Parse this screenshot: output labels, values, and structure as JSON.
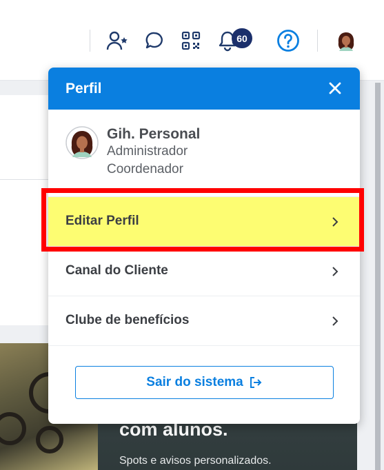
{
  "header": {
    "notification_count": "60",
    "icons": [
      "user-star-icon",
      "chat-icon",
      "qr-code-icon",
      "bell-icon",
      "help-icon"
    ]
  },
  "background": {
    "promo_title": "com alunos.",
    "promo_subtitle": "Spots e avisos personalizados."
  },
  "profile_popup": {
    "title": "Perfil",
    "user": {
      "name": "Gih. Personal",
      "role_1": "Administrador",
      "role_2": "Coordenador"
    },
    "menu": [
      {
        "label": "Editar Perfil",
        "highlighted": true
      },
      {
        "label": "Canal do Cliente",
        "highlighted": false
      },
      {
        "label": "Clube de benefícios",
        "highlighted": false
      }
    ],
    "logout_label": "Sair do sistema"
  },
  "colors": {
    "accent": "#0a7fe0",
    "badge": "#1b2f6b",
    "highlight": "#fdfd72",
    "annotation": "#ff0000"
  }
}
